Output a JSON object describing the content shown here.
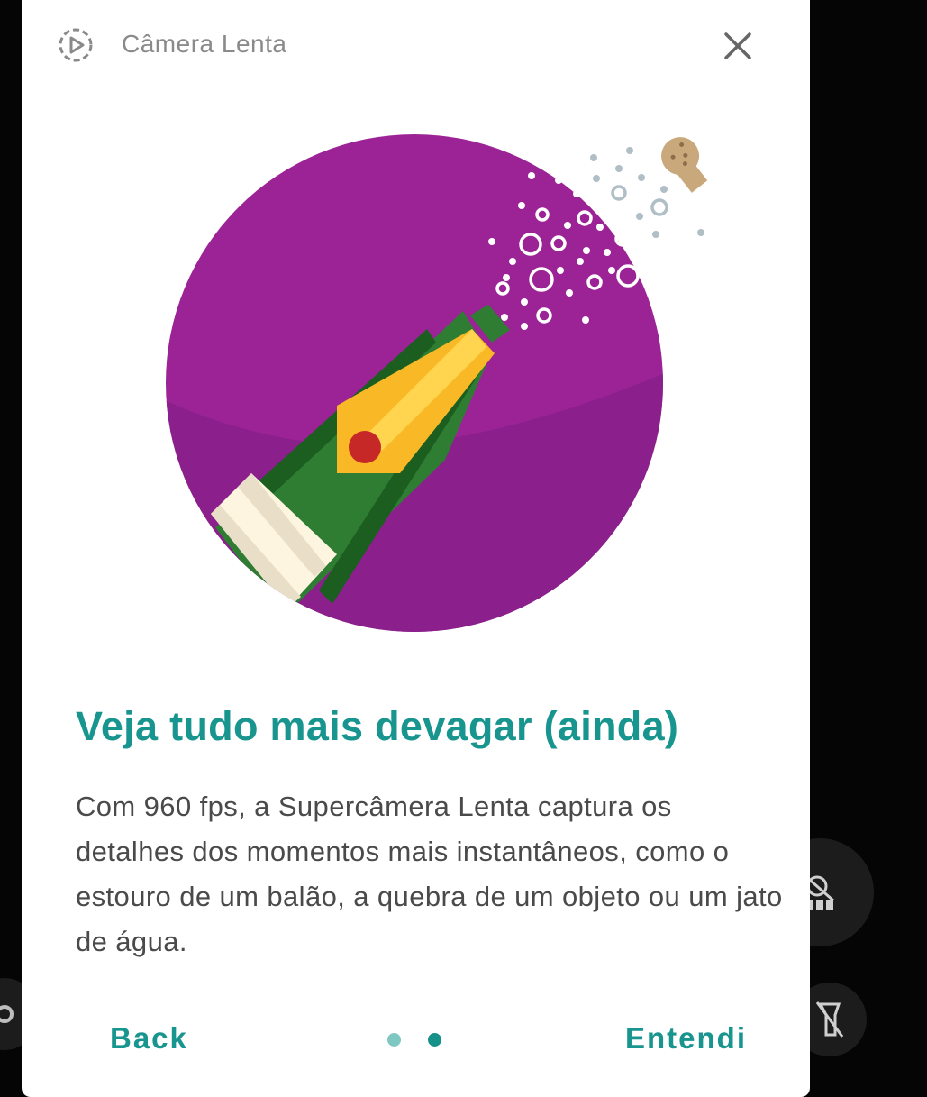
{
  "dialog": {
    "mode_title": "Câmera Lenta",
    "headline": "Veja tudo mais devagar (ainda)",
    "body": "Com 960 fps, a Supercâmera Lenta captura os detalhes dos momentos mais instantâneos, como o estouro de um balão, a quebra de um objeto ou um jato de água.",
    "back_label": "Back",
    "confirm_label": "Entendi",
    "pager": {
      "total": 2,
      "current": 2
    }
  },
  "icons": {
    "mode": "slow-motion-icon",
    "close": "close-icon",
    "illustration": "champagne-bottle-illustration",
    "bg_motion": "motion-off-icon",
    "bg_flash": "flash-off-icon"
  },
  "colors": {
    "accent": "#17958e",
    "circle": "#9b2396",
    "circle_dark": "#8b1f8c",
    "bottle_green": "#2e7d32",
    "label_yellow": "#f9b927",
    "seal_red": "#c62828"
  }
}
